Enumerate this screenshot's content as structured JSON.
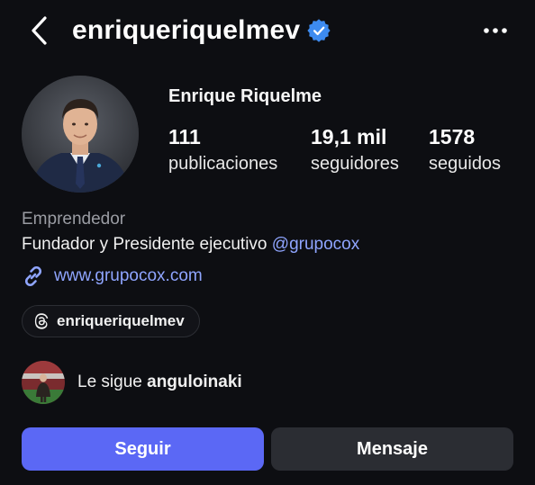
{
  "header": {
    "username": "enriqueriquelmev",
    "back_icon": "chevron-left-icon",
    "verified_icon": "verified-badge-icon",
    "more_icon": "more-horizontal-icon"
  },
  "profile": {
    "full_name": "Enrique Riquelme",
    "stats": [
      {
        "value": "111",
        "label": "publicaciones"
      },
      {
        "value": "19,1 mil",
        "label": "seguidores"
      },
      {
        "value": "1578",
        "label": "seguidos"
      }
    ],
    "category": "Emprendedor",
    "bio_text": "Fundador y Presidente ejecutivo ",
    "bio_mention": "@grupocox",
    "link": "www.grupocox.com",
    "threads_handle": "enriqueriquelmev",
    "followed_by_prefix": "Le sigue ",
    "followed_by_user": "angulોinaki"
  },
  "actions": {
    "follow_label": "Seguir",
    "message_label": "Mensaje"
  },
  "colors": {
    "background": "#0d0e12",
    "accent": "#5b68f5",
    "link": "#8fa5ff",
    "verified": "#3d8bf0",
    "secondary_button": "#2b2d33"
  }
}
